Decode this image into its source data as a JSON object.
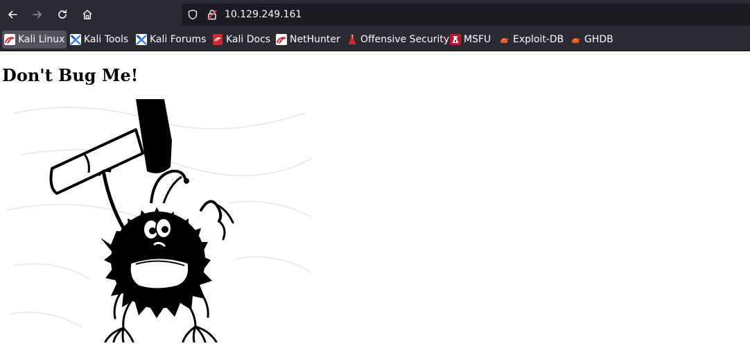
{
  "browser": {
    "url": "10.129.249.161"
  },
  "bookmarks": [
    {
      "label": "Kali Linux",
      "icon": "kali-dragon-icon",
      "active": true
    },
    {
      "label": "Kali Tools",
      "icon": "kali-tools-icon",
      "active": false
    },
    {
      "label": "Kali Forums",
      "icon": "kali-forums-icon",
      "active": false
    },
    {
      "label": "Kali Docs",
      "icon": "kali-docs-icon",
      "active": false
    },
    {
      "label": "NetHunter",
      "icon": "nethunter-icon",
      "active": false
    },
    {
      "label": "Offensive Security",
      "icon": "offsec-icon",
      "active": false
    },
    {
      "label": "MSFU",
      "icon": "msfu-icon",
      "active": false
    },
    {
      "label": "Exploit-DB",
      "icon": "exploit-db-icon",
      "active": false
    },
    {
      "label": "GHDB",
      "icon": "ghdb-icon",
      "active": false
    }
  ],
  "page": {
    "heading": "Don't Bug Me!",
    "image": "cartoon-bug-with-hammer"
  },
  "colors": {
    "toolbar": "#2b2a33",
    "urlbar": "#1c1b22",
    "text": "#fbfbfe",
    "active_bookmark": "#52525e",
    "kali_red": "#d6262e"
  }
}
